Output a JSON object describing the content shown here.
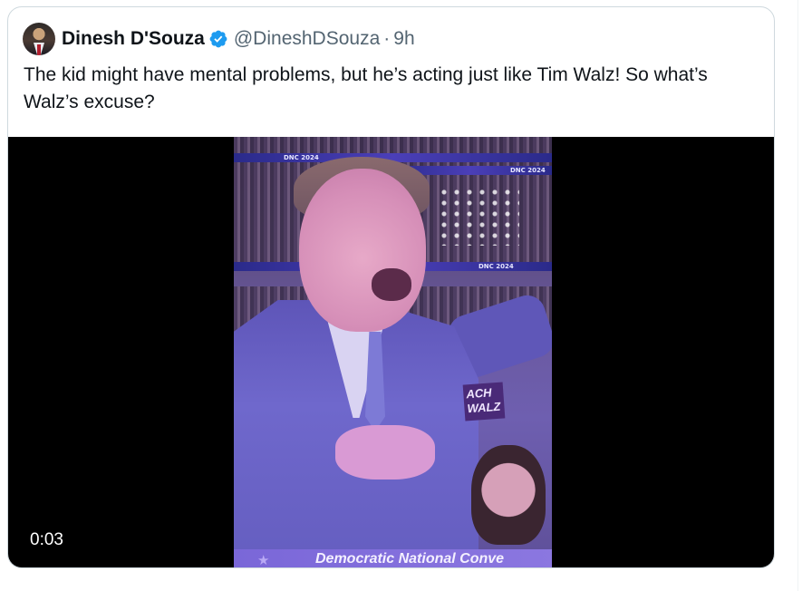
{
  "tweet": {
    "author_name": "Dinesh D'Souza",
    "handle": "@DineshDSouza",
    "separator": "·",
    "time": "9h",
    "text": "The kid might have mental problems, but he’s acting just like Tim Walz! So what’s Walz’s excuse?"
  },
  "media": {
    "duration": "0:03",
    "banner_text_1": "DNC 2024",
    "banner_text_2": "DNC 2024",
    "banner_text_3": "DNC 2024",
    "sign_text": "ACH WALZ",
    "lower_third_caption": "Democratic National Conve"
  },
  "colors": {
    "verified_badge": "#1d9bf0",
    "text_primary": "#0f1419",
    "text_secondary": "#536471",
    "border": "#cfd9de"
  },
  "icons": {
    "verified": "verified-badge-icon"
  }
}
